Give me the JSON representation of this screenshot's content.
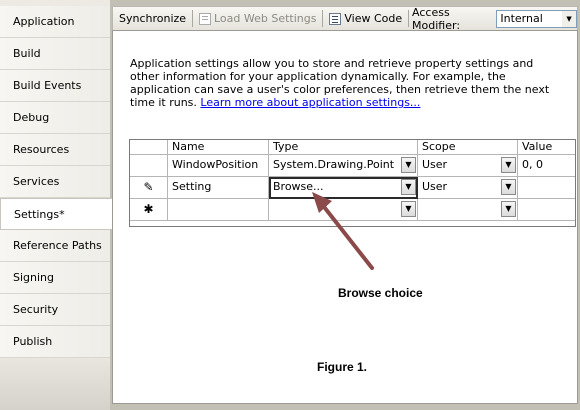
{
  "tabs": [
    {
      "label": "Application"
    },
    {
      "label": "Build"
    },
    {
      "label": "Build Events"
    },
    {
      "label": "Debug"
    },
    {
      "label": "Resources"
    },
    {
      "label": "Services"
    },
    {
      "label": "Settings*",
      "active": true
    },
    {
      "label": "Reference Paths"
    },
    {
      "label": "Signing"
    },
    {
      "label": "Security"
    },
    {
      "label": "Publish"
    }
  ],
  "toolbar": {
    "synchronize": "Synchronize",
    "load_web_settings": "Load Web Settings",
    "view_code": "View Code",
    "access_modifier_label": "Access Modifier:",
    "access_modifier_value": "Internal"
  },
  "description": {
    "text": "Application settings allow you to store and retrieve property settings and other information for your application dynamically. For example, the application can save a user's color preferences, then retrieve them the next time it runs.",
    "link": "Learn more about application settings..."
  },
  "grid": {
    "columns": [
      "Name",
      "Type",
      "Scope",
      "Value"
    ],
    "rows": [
      {
        "name": "WindowPosition",
        "type": "System.Drawing.Point",
        "scope": "User",
        "value": "0, 0"
      },
      {
        "name": "Setting",
        "type": "Browse...",
        "scope": "User",
        "value": ""
      },
      {
        "name": "",
        "type": "",
        "scope": "",
        "value": ""
      }
    ],
    "row_markers": [
      "",
      "pencil",
      "asterisk"
    ]
  },
  "annotation": {
    "callout": "Browse choice",
    "figure": "Figure 1."
  },
  "colors": {
    "tab_strip": "#eceae3",
    "panel_frame": "#c2bfb4",
    "arrow": "#8b4a4a",
    "link": "#0000ee"
  }
}
